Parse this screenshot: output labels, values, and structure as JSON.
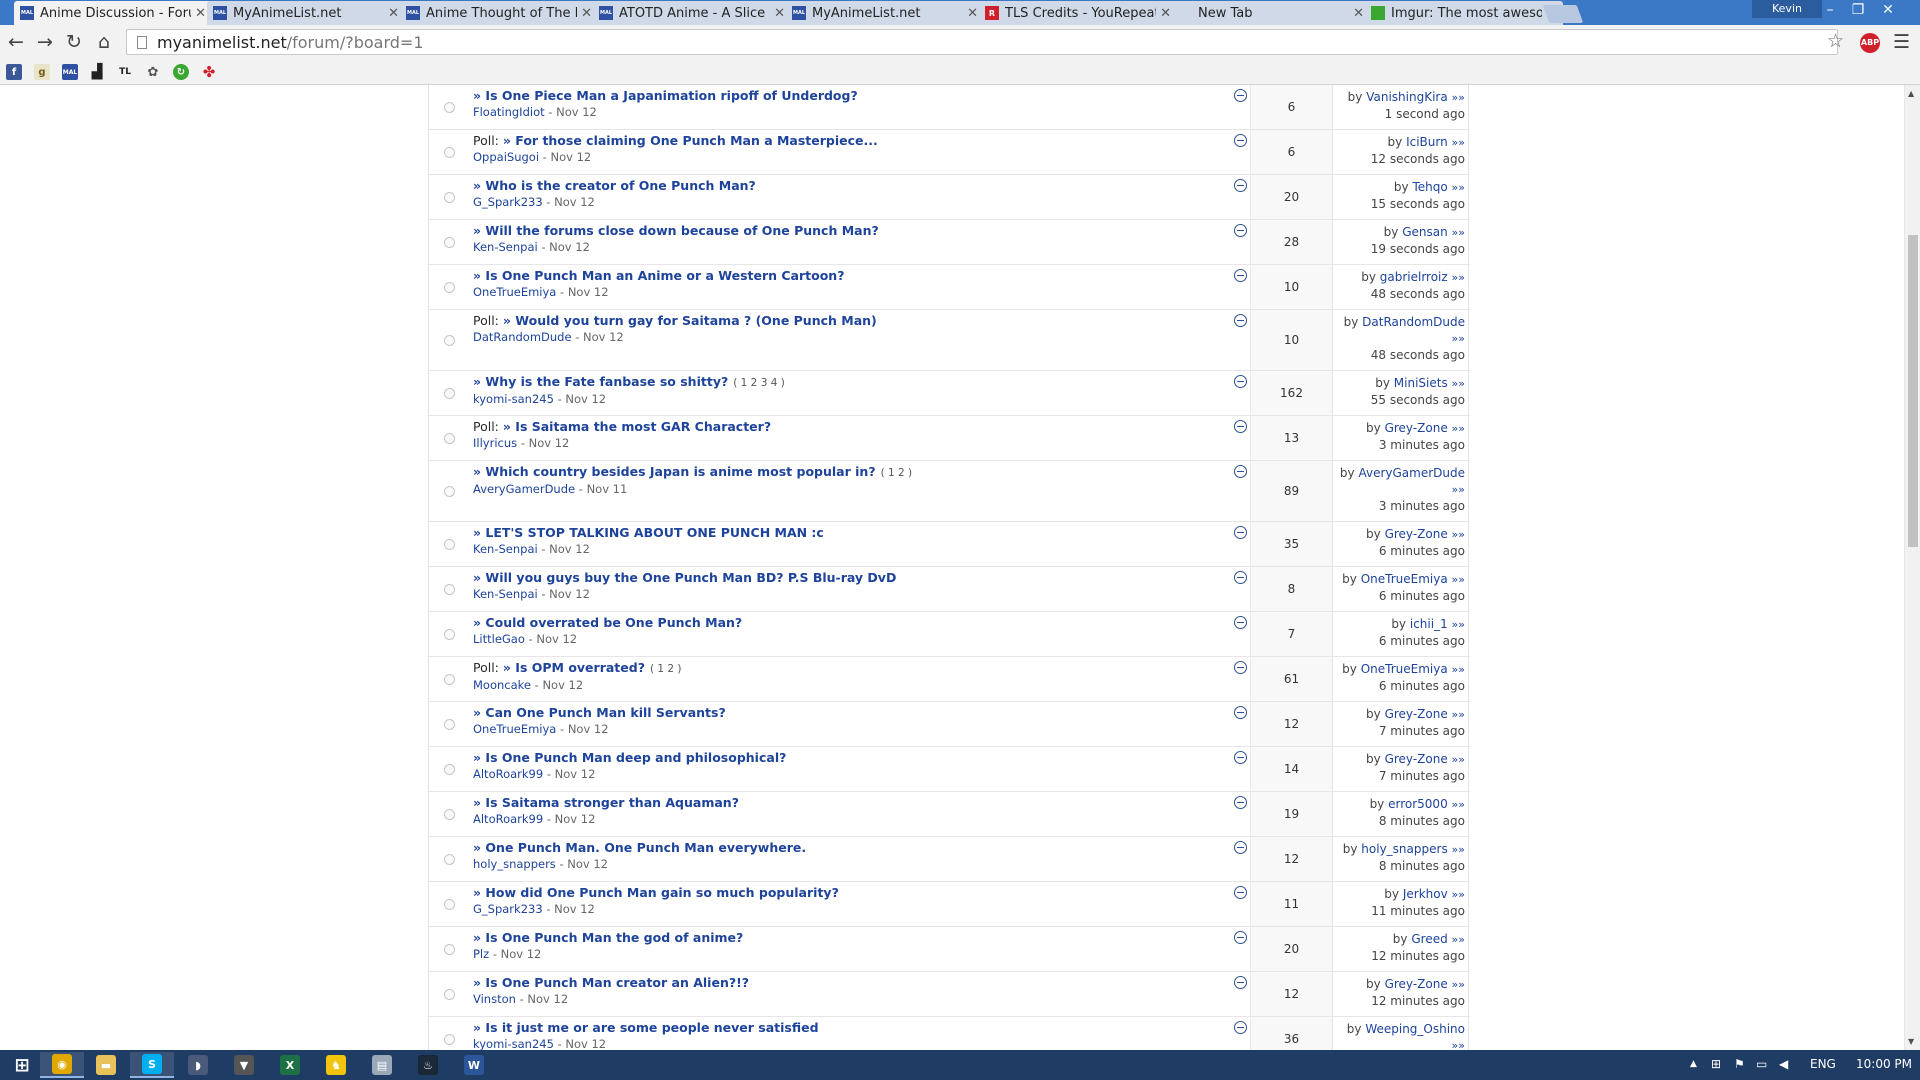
{
  "browser": {
    "tabs": [
      {
        "title": "Anime Discussion - Forum",
        "favicon": "mal-icon",
        "active": true
      },
      {
        "title": "MyAnimeList.net",
        "favicon": "mal-icon",
        "active": false
      },
      {
        "title": "Anime Thought of The Da",
        "favicon": "mal-icon",
        "active": false
      },
      {
        "title": "ATOTD Anime - A Slice of",
        "favicon": "mal-icon",
        "active": false
      },
      {
        "title": "MyAnimeList.net",
        "favicon": "mal-icon",
        "active": false
      },
      {
        "title": "TLS Credits - YouRepeat",
        "favicon": "yourepeat-icon",
        "active": false
      },
      {
        "title": "New Tab",
        "favicon": "none",
        "active": false
      },
      {
        "title": "Imgur: The most awesome",
        "favicon": "imgur-icon",
        "active": false
      }
    ],
    "user": "Kevin",
    "url_host": "myanimelist.net",
    "url_path": "/forum/?board=1",
    "bookmarks": [
      "facebook-icon",
      "goodreads-icon",
      "mal-icon",
      "stats-icon",
      "tl-icon",
      "cat-icon",
      "green-icon",
      "red-clover-icon"
    ]
  },
  "forum": {
    "topics": [
      {
        "prefix": "",
        "title": "» Is One Piece Man a Japanimation ripoff of Underdog?",
        "pages": "",
        "author": "FloatingIdiot",
        "date": "Nov 12",
        "replies": "6",
        "last_by": "VanishingKira",
        "last_time": "1 second ago"
      },
      {
        "prefix": "Poll: ",
        "title": "» For those claiming One Punch Man a Masterpiece...",
        "pages": "",
        "author": "OppaiSugoi",
        "date": "Nov 12",
        "replies": "6",
        "last_by": "IciBurn",
        "last_time": "12 seconds ago"
      },
      {
        "prefix": "",
        "title": "» Who is the creator of One Punch Man?",
        "pages": "",
        "author": "G_Spark233",
        "date": "Nov 12",
        "replies": "20",
        "last_by": "Tehqo",
        "last_time": "15 seconds ago"
      },
      {
        "prefix": "",
        "title": "» Will the forums close down because of One Punch Man?",
        "pages": "",
        "author": "Ken-Senpai",
        "date": "Nov 12",
        "replies": "28",
        "last_by": "Gensan",
        "last_time": "19 seconds ago"
      },
      {
        "prefix": "",
        "title": "» Is One Punch Man an Anime or a Western Cartoon?",
        "pages": "",
        "author": "OneTrueEmiya",
        "date": "Nov 12",
        "replies": "10",
        "last_by": "gabrielrroiz",
        "last_time": "48 seconds ago"
      },
      {
        "prefix": "Poll: ",
        "title": "» Would you turn gay for Saitama ? (One Punch Man)",
        "pages": "",
        "author": "DatRandomDude",
        "date": "Nov 12",
        "replies": "10",
        "last_by": "DatRandomDude",
        "last_time": "48 seconds ago"
      },
      {
        "prefix": "",
        "title": "» Why is the Fate fanbase so shitty?",
        "pages": "( 1 2 3 4 )",
        "author": "kyomi-san245",
        "date": "Nov 12",
        "replies": "162",
        "last_by": "MiniSiets",
        "last_time": "55 seconds ago"
      },
      {
        "prefix": "Poll: ",
        "title": "» Is Saitama the most GAR Character?",
        "pages": "",
        "author": "Illyricus",
        "date": "Nov 12",
        "replies": "13",
        "last_by": "Grey-Zone",
        "last_time": "3 minutes ago"
      },
      {
        "prefix": "",
        "title": "» Which country besides Japan is anime most popular in?",
        "pages": "( 1 2 )",
        "author": "AveryGamerDude",
        "date": "Nov 11",
        "replies": "89",
        "last_by": "AveryGamerDude",
        "last_time": "3 minutes ago"
      },
      {
        "prefix": "",
        "title": "» LET'S STOP TALKING ABOUT ONE PUNCH MAN :c",
        "pages": "",
        "author": "Ken-Senpai",
        "date": "Nov 12",
        "replies": "35",
        "last_by": "Grey-Zone",
        "last_time": "6 minutes ago"
      },
      {
        "prefix": "",
        "title": "» Will you guys buy the One Punch Man BD? P.S Blu-ray DvD",
        "pages": "",
        "author": "Ken-Senpai",
        "date": "Nov 12",
        "replies": "8",
        "last_by": "OneTrueEmiya",
        "last_time": "6 minutes ago"
      },
      {
        "prefix": "",
        "title": "» Could overrated be One Punch Man?",
        "pages": "",
        "author": "LittleGao",
        "date": "Nov 12",
        "replies": "7",
        "last_by": "ichii_1",
        "last_time": "6 minutes ago"
      },
      {
        "prefix": "Poll: ",
        "title": "» Is OPM overrated?",
        "pages": "( 1 2 )",
        "author": "Mooncake",
        "date": "Nov 12",
        "replies": "61",
        "last_by": "OneTrueEmiya",
        "last_time": "6 minutes ago"
      },
      {
        "prefix": "",
        "title": "» Can One Punch Man kill Servants?",
        "pages": "",
        "author": "OneTrueEmiya",
        "date": "Nov 12",
        "replies": "12",
        "last_by": "Grey-Zone",
        "last_time": "7 minutes ago"
      },
      {
        "prefix": "",
        "title": "» Is One Punch Man deep and philosophical?",
        "pages": "",
        "author": "AltoRoark99",
        "date": "Nov 12",
        "replies": "14",
        "last_by": "Grey-Zone",
        "last_time": "7 minutes ago"
      },
      {
        "prefix": "",
        "title": "» Is Saitama stronger than Aquaman?",
        "pages": "",
        "author": "AltoRoark99",
        "date": "Nov 12",
        "replies": "19",
        "last_by": "error5000",
        "last_time": "8 minutes ago"
      },
      {
        "prefix": "",
        "title": "» One Punch Man. One Punch Man everywhere.",
        "pages": "",
        "author": "holy_snappers",
        "date": "Nov 12",
        "replies": "12",
        "last_by": "holy_snappers",
        "last_time": "8 minutes ago"
      },
      {
        "prefix": "",
        "title": "» How did One Punch Man gain so much popularity?",
        "pages": "",
        "author": "G_Spark233",
        "date": "Nov 12",
        "replies": "11",
        "last_by": "Jerkhov",
        "last_time": "11 minutes ago"
      },
      {
        "prefix": "",
        "title": "» Is One Punch Man the god of anime?",
        "pages": "",
        "author": "Plz",
        "date": "Nov 12",
        "replies": "20",
        "last_by": "Greed",
        "last_time": "12 minutes ago"
      },
      {
        "prefix": "",
        "title": "» Is One Punch Man creator an Alien?!?",
        "pages": "",
        "author": "Vinston",
        "date": "Nov 12",
        "replies": "12",
        "last_by": "Grey-Zone",
        "last_time": "12 minutes ago"
      },
      {
        "prefix": "",
        "title": "» Is it just me or are some people never satisfied",
        "pages": "",
        "author": "kyomi-san245",
        "date": "Nov 12",
        "replies": "36",
        "last_by": "Weeping_Oshino",
        "last_time": ""
      }
    ],
    "by_label": "by",
    "sep": " - ",
    "arrow": "»»"
  },
  "taskbar": {
    "apps": [
      "windows-start-icon",
      "chrome-icon",
      "file-explorer-icon",
      "skype-icon",
      "media-icon",
      "shield-icon",
      "excel-icon",
      "aim-icon",
      "notes-icon",
      "steam-icon",
      "word-icon"
    ],
    "language": "ENG",
    "clock": "10:00 PM"
  },
  "colors": {
    "link": "#1d439b",
    "chrome_blue": "#3b78c6",
    "taskbar": "#1f3c64"
  }
}
